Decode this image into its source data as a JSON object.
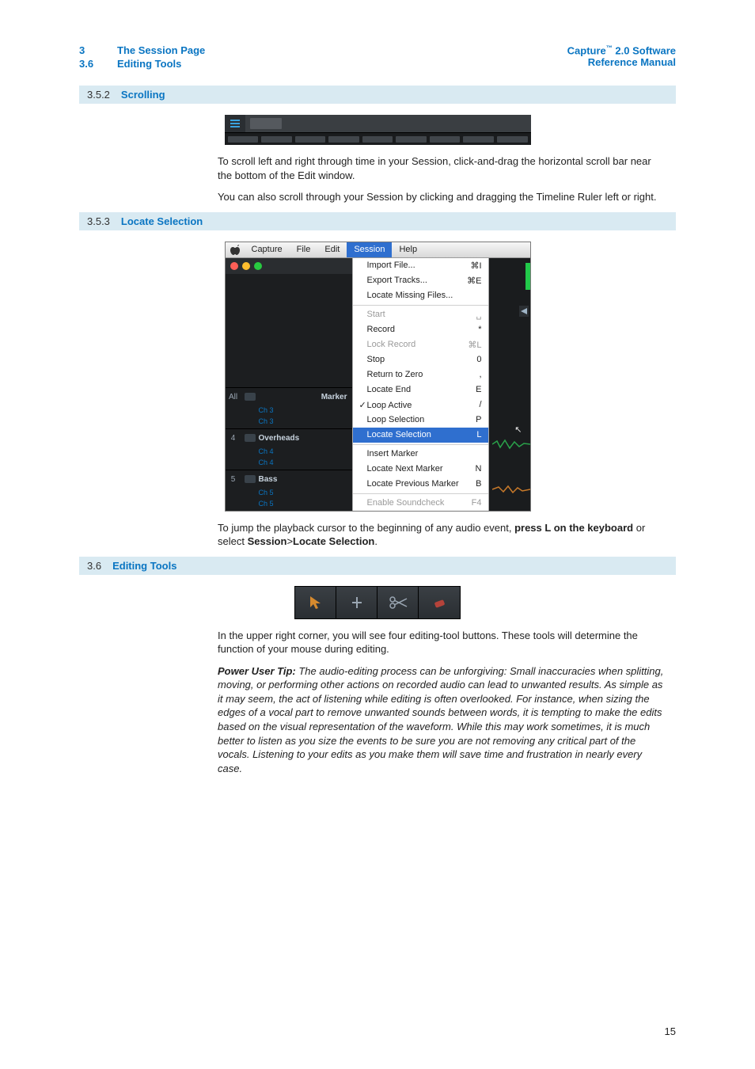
{
  "header": {
    "left": {
      "chapter_num": "3",
      "chapter_title": "The Session Page",
      "section_num": "3.6",
      "section_title": "Editing Tools"
    },
    "right": {
      "product": "Capture",
      "tm": "™",
      "version": " 2.0 Software",
      "line2": "Reference Manual"
    }
  },
  "sections": {
    "s1": {
      "num": "3.5.2",
      "title": "Scrolling"
    },
    "s2": {
      "num": "3.5.3",
      "title": "Locate Selection"
    },
    "s3": {
      "num": "3.6",
      "title": "Editing Tools"
    }
  },
  "body": {
    "scroll_p1": "To scroll left and right through time in your Session, click-and-drag the horizontal scroll bar near the bottom of the Edit window.",
    "scroll_p2": "You can also scroll through your Session by clicking and dragging the Timeline Ruler left or right.",
    "locate_p1_a": "To jump the playback cursor to the beginning of any audio event, ",
    "locate_p1_b": "press L on the keyboard",
    "locate_p1_c": " or select ",
    "locate_p1_d": "Session",
    "locate_p1_e": ">",
    "locate_p1_f": "Locate Selection",
    "locate_p1_g": ".",
    "tools_p1": "In the upper right corner, you will see four editing-tool buttons. These tools will determine the function of your mouse during editing.",
    "tip_lead": "Power User Tip:",
    "tip_body": " The audio-editing process can be unforgiving: Small inaccuracies when splitting, moving, or performing other actions on recorded audio can lead to unwanted results. As simple as it may seem, the act of listening while editing is often overlooked. For instance, when sizing the edges of a vocal part to remove unwanted sounds between words, it is tempting to make the edits based on the visual representation of the waveform. While this may work sometimes, it is much better to listen as you size the events to be sure you are not removing any critical part of the vocals. Listening to your edits as you make them will save time and frustration in nearly every case."
  },
  "menubar": {
    "apple_icon": "apple-icon",
    "items": [
      "Capture",
      "File",
      "Edit",
      "Session",
      "Help"
    ],
    "selected": "Session"
  },
  "session_menu": {
    "groups": [
      [
        {
          "label": "Import File...",
          "shortcut": "⌘I",
          "enabled": true
        },
        {
          "label": "Export Tracks...",
          "shortcut": "⌘E",
          "enabled": true
        },
        {
          "label": "Locate Missing Files...",
          "shortcut": "",
          "enabled": true
        }
      ],
      [
        {
          "label": "Start",
          "shortcut": "␣",
          "enabled": false
        },
        {
          "label": "Record",
          "shortcut": "*",
          "enabled": true
        },
        {
          "label": "Lock Record",
          "shortcut": "⌘L",
          "enabled": false
        },
        {
          "label": "Stop",
          "shortcut": "0",
          "enabled": true
        },
        {
          "label": "Return to Zero",
          "shortcut": ",",
          "enabled": true
        },
        {
          "label": "Locate End",
          "shortcut": "E",
          "enabled": true
        },
        {
          "label": "Loop Active",
          "shortcut": "/",
          "enabled": true,
          "checked": true
        },
        {
          "label": "Loop Selection",
          "shortcut": "P",
          "enabled": true
        },
        {
          "label": "Locate Selection",
          "shortcut": "L",
          "enabled": true,
          "highlight": true
        }
      ],
      [
        {
          "label": "Insert Marker",
          "shortcut": "",
          "enabled": true
        },
        {
          "label": "Locate Next Marker",
          "shortcut": "N",
          "enabled": true
        },
        {
          "label": "Locate Previous Marker",
          "shortcut": "B",
          "enabled": true
        }
      ],
      [
        {
          "label": "Enable Soundcheck",
          "shortcut": "F4",
          "enabled": false
        }
      ]
    ]
  },
  "tracks": {
    "marker_row": {
      "num": "All",
      "name": "Marker"
    },
    "t3_sub1": "Ch 3",
    "t3_sub2": "Ch 3",
    "t4": {
      "num": "4",
      "name": "Overheads",
      "sub1": "Ch 4",
      "sub2": "Ch 4"
    },
    "t5": {
      "num": "5",
      "name": "Bass",
      "sub1": "Ch 5",
      "sub2": "Ch 5"
    }
  },
  "tool_icons": [
    "arrow-tool-icon",
    "split-tool-icon",
    "pencil-tool-icon",
    "eraser-tool-icon"
  ],
  "page_number": "15",
  "colors": {
    "accent": "#0a75c2",
    "section_bg": "#d9eaf2",
    "menu_highlight": "#2f6fcf"
  }
}
